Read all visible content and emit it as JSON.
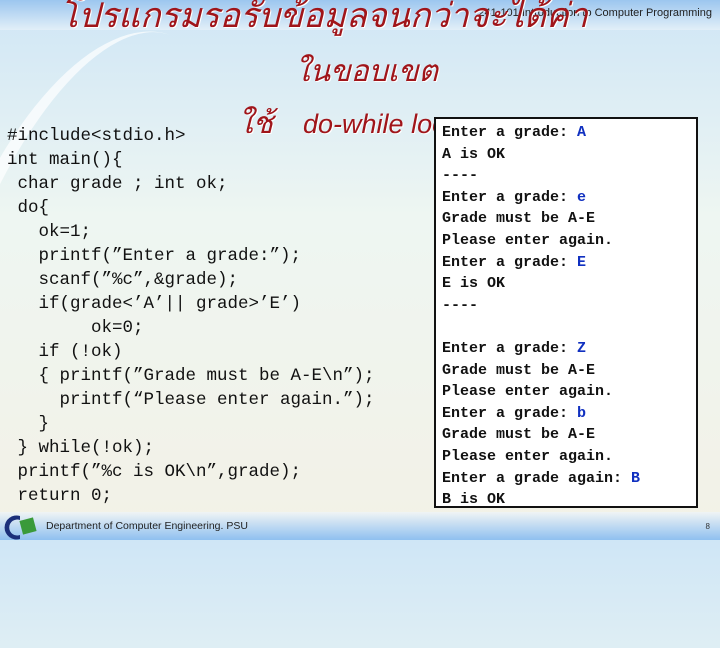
{
  "header": {
    "course": "241-101 Introduction to Computer Programming"
  },
  "title": {
    "line1": "โปรแกรมรอรับข้อมูลจนกว่าจะได้ค่า",
    "line2": "ในขอบเขต",
    "line3_thai": "ใช้",
    "line3_en": "do-while loop"
  },
  "code": [
    "#include<stdio.h>",
    "int main(){",
    " char grade ; int ok;",
    " do{",
    "   ok=1;",
    "   printf(”Enter a grade:”);",
    "   scanf(”%c”,&grade);",
    "   if(grade<’A’|| grade>’E’)",
    "        ok=0;",
    "   if (!ok)",
    "   { printf(”Grade must be A-E\\n”);",
    "     printf(“Please enter again.”);",
    "   }",
    " } while(!ok);",
    " printf(”%c is OK\\n”,grade);",
    " return 0;"
  ],
  "output": [
    {
      "text": "Enter a grade: ",
      "input": "A"
    },
    {
      "text": "A is OK"
    },
    {
      "text": "----"
    },
    {
      "text": "Enter a grade: ",
      "input": "e"
    },
    {
      "text": "Grade must be A-E"
    },
    {
      "text": "Please enter again."
    },
    {
      "text": "Enter a grade: ",
      "input": "E"
    },
    {
      "text": "E is OK"
    },
    {
      "text": "----"
    },
    {
      "text": ""
    },
    {
      "text": "Enter a grade: ",
      "input": "Z"
    },
    {
      "text": "Grade must be A-E"
    },
    {
      "text": "Please enter again."
    },
    {
      "text": "Enter a grade: ",
      "input": "b"
    },
    {
      "text": "Grade must be A-E"
    },
    {
      "text": "Please enter again."
    },
    {
      "text": "Enter a grade again: ",
      "input": "B"
    },
    {
      "text": "B is OK"
    },
    {
      "text": "----"
    }
  ],
  "footer": {
    "department": "Department of Computer Engineering. PSU",
    "page": "8"
  },
  "colors": {
    "title": "#a0151a",
    "input": "#1030c0"
  }
}
